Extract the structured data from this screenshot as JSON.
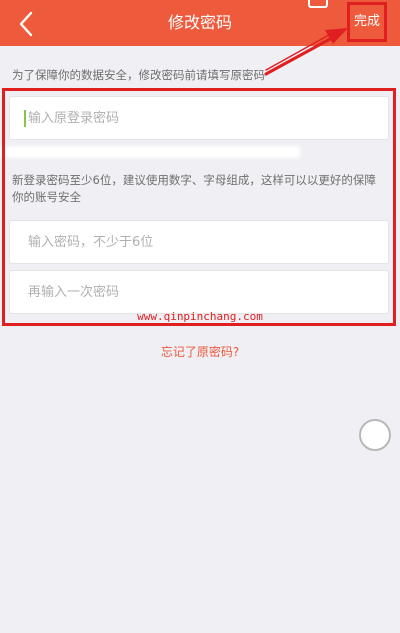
{
  "header": {
    "title": "修改密码",
    "done_label": "完成",
    "back_icon": "chevron-left-icon",
    "background_color": "#ee5a3c"
  },
  "hints": {
    "top": "为了保障你的数据安全，修改密码前请填写原密码",
    "rules": "新登录密码至少6位，建议使用数字、字母组成，这样可以以更好的保障你的账号安全"
  },
  "fields": {
    "old_password": {
      "placeholder": "输入原登录密码",
      "value": ""
    },
    "new_password": {
      "placeholder": "输入密码，不少于6位",
      "value": ""
    },
    "confirm_password": {
      "placeholder": "再输入一次密码",
      "value": ""
    }
  },
  "watermark": "www.qinpinchang.com",
  "forgot_link": "忘记了原密码?",
  "accent_color": "#e02020"
}
